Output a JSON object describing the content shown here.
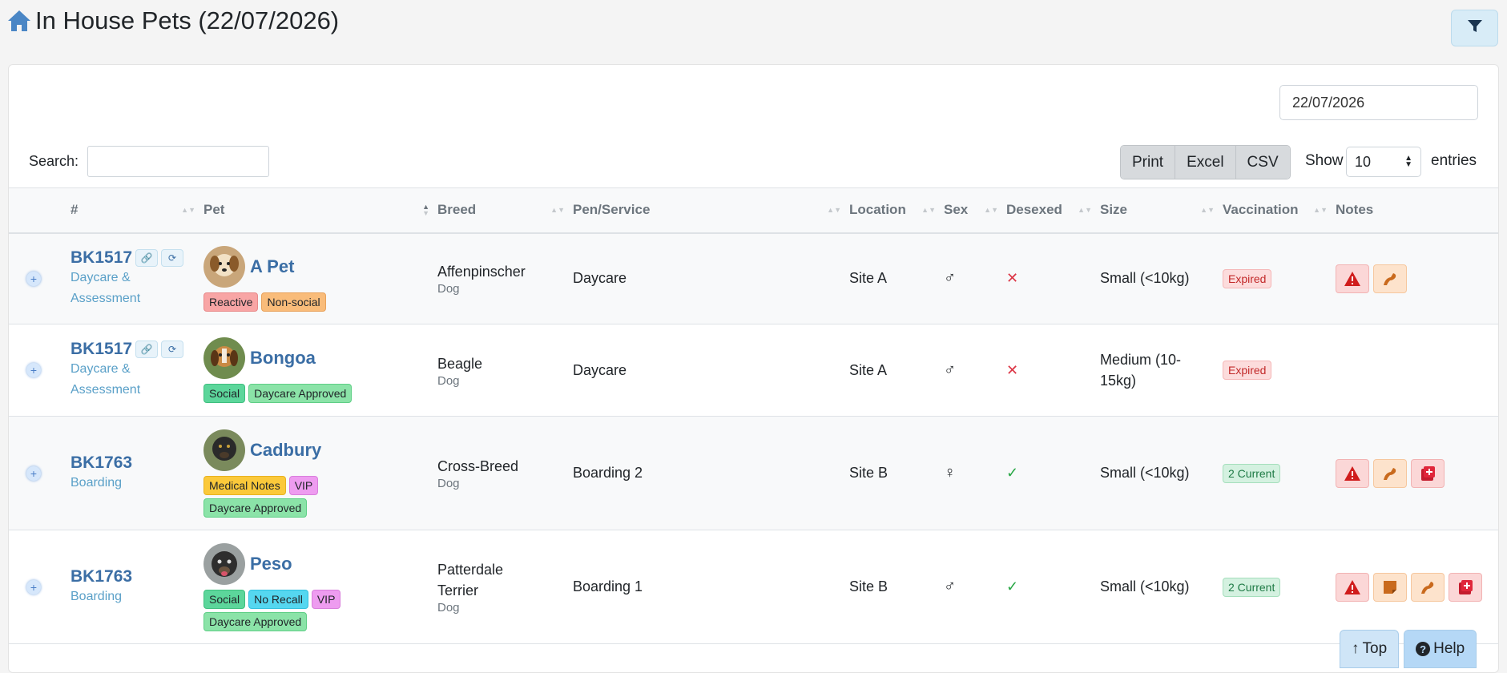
{
  "header": {
    "title": "In House Pets (22/07/2026)"
  },
  "controls": {
    "date_value": "22/07/2026",
    "search_label": "Search:",
    "search_value": "",
    "export_buttons": [
      "Print",
      "Excel",
      "CSV"
    ],
    "show_label": "Show",
    "page_length": "10",
    "entries_label": "entries"
  },
  "table": {
    "columns": [
      "#",
      "Pet",
      "Breed",
      "Pen/Service",
      "Location",
      "Sex",
      "Desexed",
      "Size",
      "Vaccination",
      "Notes"
    ],
    "rows": [
      {
        "booking": "BK1517",
        "service": "Daycare & Assessment",
        "pet": "A Pet",
        "tags": [
          "Reactive",
          "Non-social"
        ],
        "breed": "Affenpinscher",
        "species": "Dog",
        "pen": "Daycare",
        "location": "Site A",
        "sex": "male",
        "desexed": "no",
        "size": "Small (<10kg)",
        "vaccination": "Expired",
        "notes": [
          "warning-icon",
          "paw-icon"
        ]
      },
      {
        "booking": "BK1517",
        "service": "Daycare & Assessment",
        "pet": "Bongoa",
        "tags": [
          "Social",
          "Daycare Approved"
        ],
        "breed": "Beagle",
        "species": "Dog",
        "pen": "Daycare",
        "location": "Site A",
        "sex": "male",
        "desexed": "no",
        "size": "Medium (10-15kg)",
        "vaccination": "Expired",
        "notes": []
      },
      {
        "booking": "BK1763",
        "service": "Boarding",
        "pet": "Cadbury",
        "tags": [
          "Medical Notes",
          "VIP",
          "Daycare Approved"
        ],
        "breed": "Cross-Breed",
        "species": "Dog",
        "pen": "Boarding 2",
        "location": "Site B",
        "sex": "female",
        "desexed": "yes",
        "size": "Small (<10kg)",
        "vaccination": "2 Current",
        "notes": [
          "warning-icon",
          "paw-icon",
          "medical-icon"
        ]
      },
      {
        "booking": "BK1763",
        "service": "Boarding",
        "pet": "Peso",
        "tags": [
          "Social",
          "No Recall",
          "VIP",
          "Daycare Approved"
        ],
        "breed": "Patterdale Terrier",
        "species": "Dog",
        "pen": "Boarding 1",
        "location": "Site B",
        "sex": "male",
        "desexed": "yes",
        "size": "Small (<10kg)",
        "vaccination": "2 Current",
        "notes": [
          "warning-icon",
          "note-icon",
          "paw-icon",
          "medical-icon"
        ]
      }
    ]
  },
  "footer_buttons": {
    "top": "Top",
    "help": "Help"
  }
}
